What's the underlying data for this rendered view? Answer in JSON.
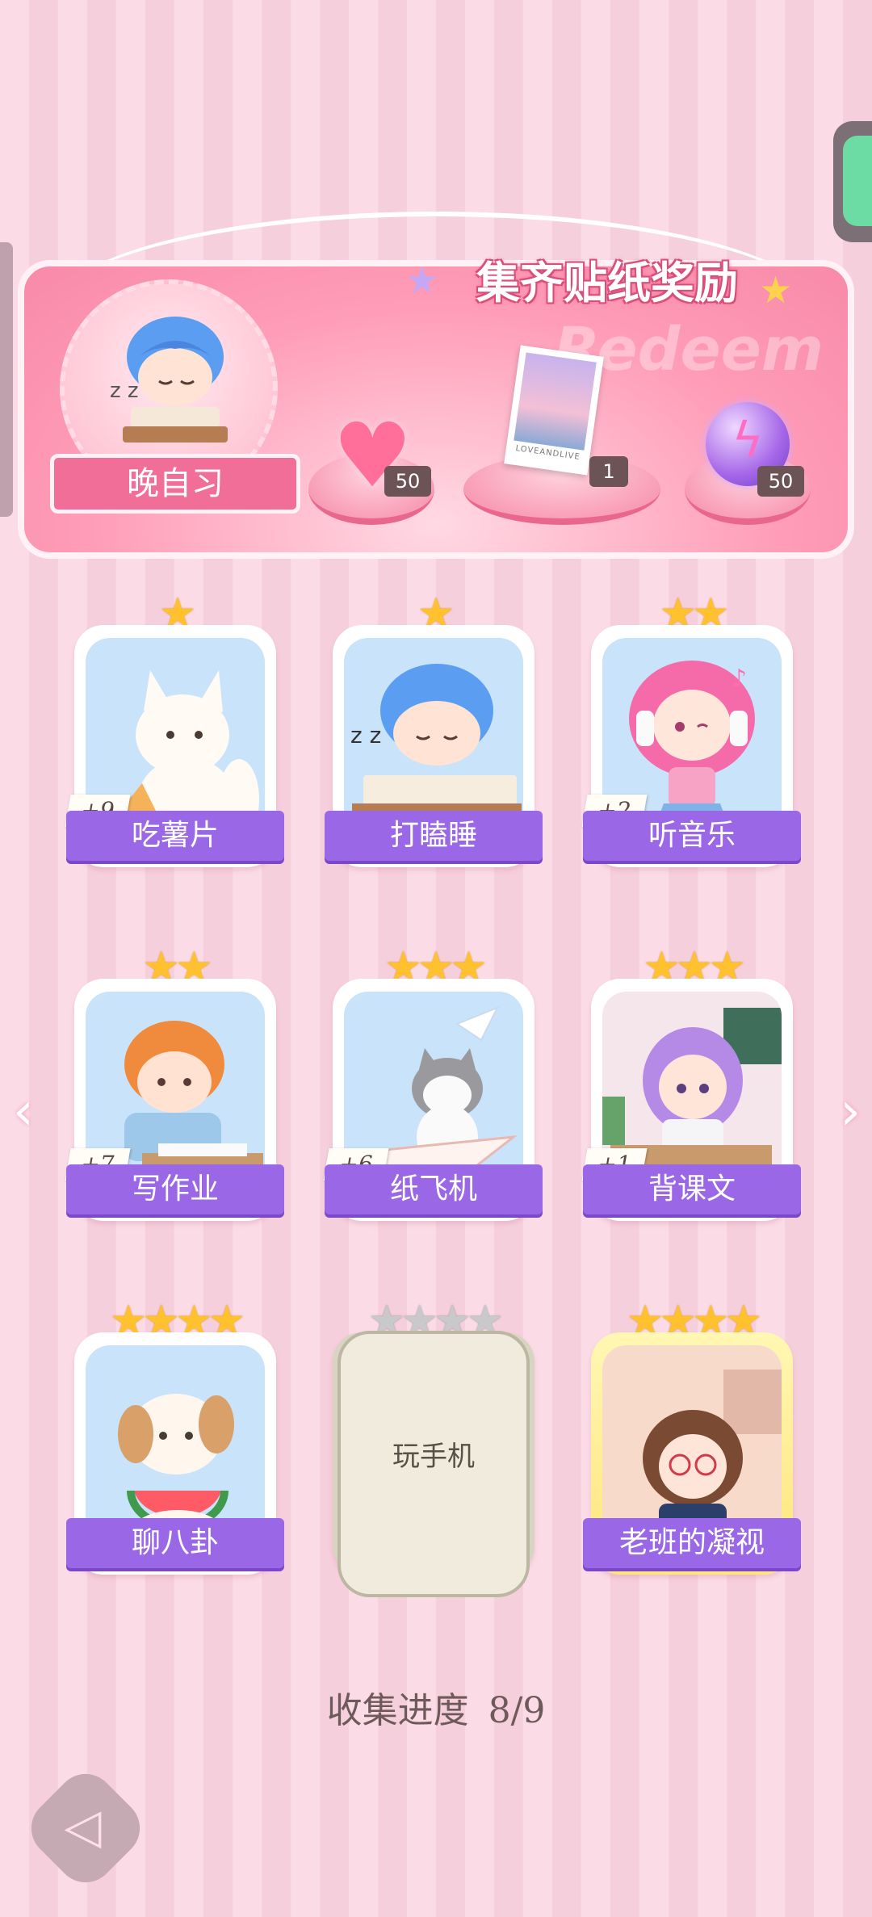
{
  "reward_banner": {
    "title": "集齐贴纸奖励",
    "watermark": "Redeem",
    "featured_sticker_label": "晚自习",
    "rewards": [
      {
        "icon": "heart-gem-icon",
        "count": "50"
      },
      {
        "icon": "postcard-icon",
        "count": "1",
        "postcard_text": "LOVEANDLIVE"
      },
      {
        "icon": "energy-orb-icon",
        "count": "50"
      }
    ]
  },
  "stickers": [
    {
      "label": "吃薯片",
      "stars": "★",
      "plus": "+9"
    },
    {
      "label": "打瞌睡",
      "stars": "★",
      "plus": ""
    },
    {
      "label": "听音乐",
      "stars": "★★",
      "plus": "+2"
    },
    {
      "label": "写作业",
      "stars": "★★",
      "plus": "+7"
    },
    {
      "label": "纸飞机",
      "stars": "★★★",
      "plus": "+6"
    },
    {
      "label": "背课文",
      "stars": "★★★",
      "plus": "+1"
    },
    {
      "label": "聊八卦",
      "stars": "★★★★",
      "plus": ""
    },
    {
      "label": "玩手机",
      "stars": "★★★★",
      "plus": "",
      "locked": true
    },
    {
      "label": "老班的凝视",
      "stars": "★★★★",
      "plus": "",
      "special": "gold"
    }
  ],
  "progress": {
    "label": "收集进度",
    "value": "8/9"
  },
  "colors": {
    "label_purple": "#9a67e6",
    "banner_pink": "#f78aa8",
    "star_gold": "#ffc22e"
  }
}
